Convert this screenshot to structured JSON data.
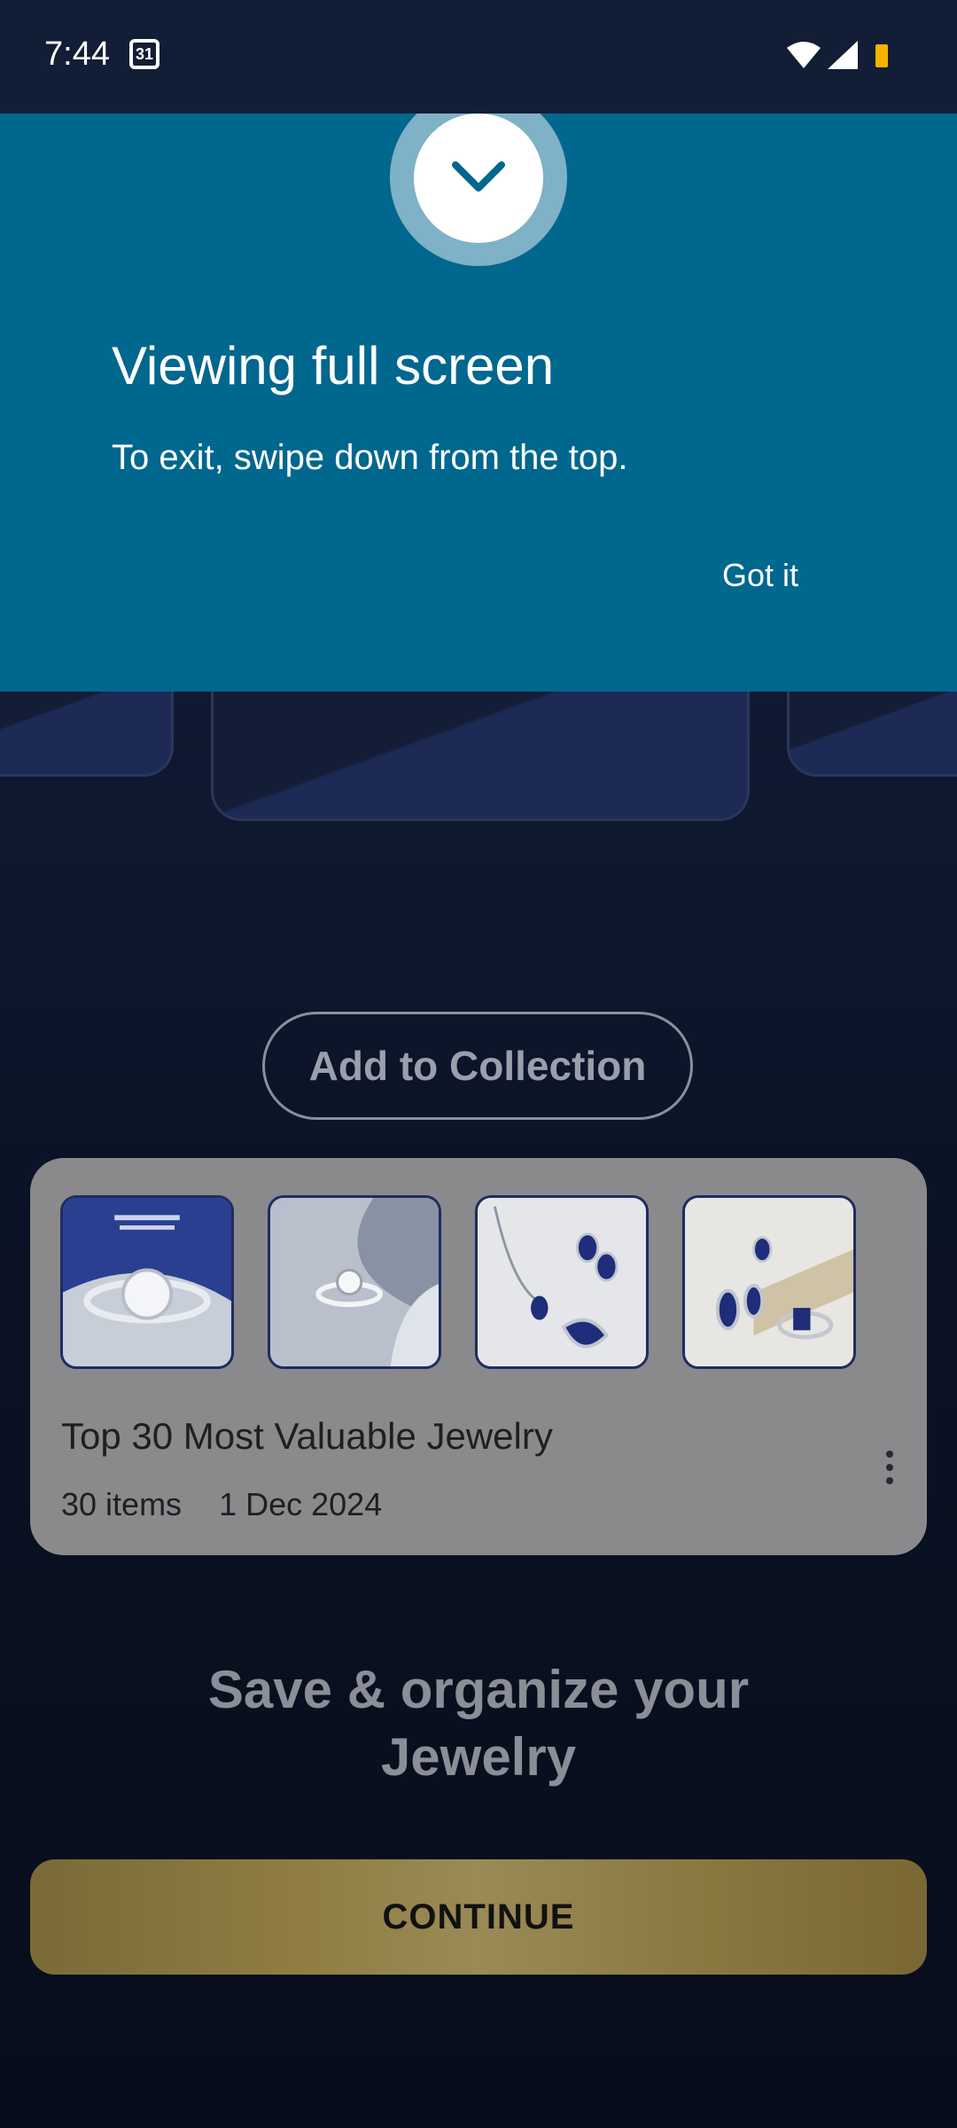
{
  "status_bar": {
    "time": "7:44",
    "calendar_day": "31"
  },
  "fullscreen_notice": {
    "title": "Viewing full screen",
    "message": "To exit, swipe down from the top.",
    "dismiss_label": "Got it"
  },
  "actions": {
    "add_to_collection": "Add to Collection"
  },
  "collection": {
    "title": "Top 30 Most Valuable Jewelry",
    "item_count": "30 items",
    "date": "1 Dec 2024",
    "thumbnails": [
      "ring-halo-icon",
      "engagement-ring-icon",
      "sapphire-necklace-earrings-icon",
      "sapphire-jewelry-set-icon"
    ]
  },
  "onboarding": {
    "headline_line1": "Save & organize your",
    "headline_line2": "Jewelry",
    "continue_label": "CONTINUE"
  }
}
